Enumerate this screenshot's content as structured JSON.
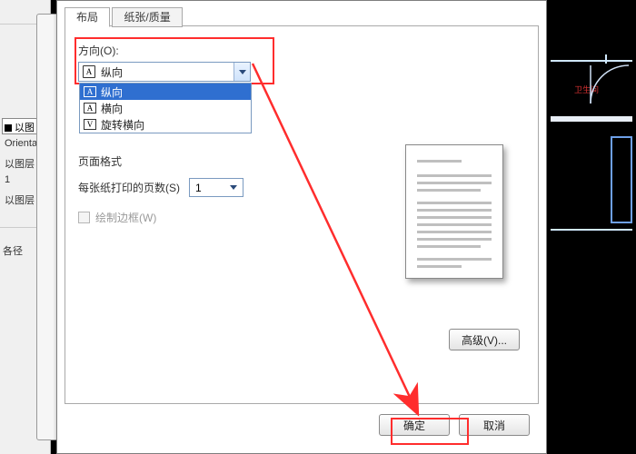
{
  "tabs": {
    "layout": "布局",
    "paperq": "纸张/质量"
  },
  "orientation": {
    "label": "方向(O):",
    "selected_icon": "A",
    "selected": "纵向",
    "options": [
      {
        "icon": "A",
        "label": "纵向",
        "kind": "portrait",
        "selected": true
      },
      {
        "icon": "A",
        "label": "横向",
        "kind": "landscape",
        "selected": false
      },
      {
        "icon": "V",
        "label": "旋转横向",
        "kind": "rot",
        "selected": false
      }
    ]
  },
  "page_format": {
    "group_label": "页面格式",
    "pages_per_sheet_label": "每张纸打印的页数(S)",
    "pages_per_sheet_value": "1",
    "draw_border_label": "绘制边框(W)",
    "draw_border_checked": false
  },
  "buttons": {
    "advanced": "高级(V)...",
    "ok": "确定",
    "cancel": "取消"
  },
  "bg_left": {
    "header": "以图",
    "row_orient": "Orientat",
    "row2": "以图层",
    "row3": "1",
    "row4": "以图层",
    "path_lbl": "各径"
  },
  "cad_label": "卫生间"
}
